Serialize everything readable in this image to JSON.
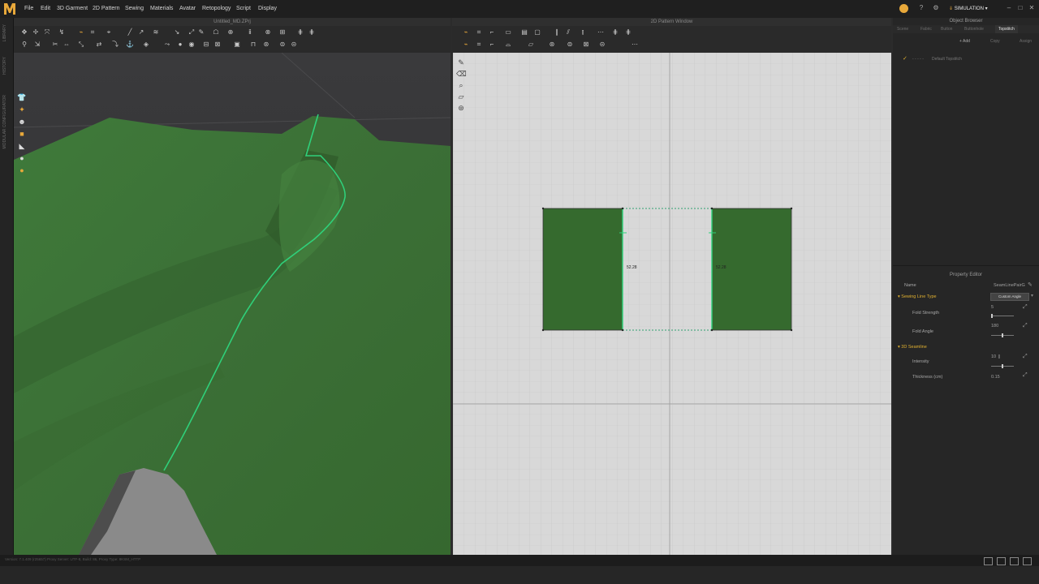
{
  "app": {
    "menu": [
      "File",
      "Edit",
      "3D Garment",
      "2D Pattern",
      "Sewing",
      "Materials",
      "Avatar",
      "Retopology",
      "Script",
      "Display"
    ],
    "mode_label": "SIMULATION",
    "colors": {
      "accent": "#e8a83a",
      "fabric": "#3b6e36",
      "pattern_fill": "#356a2e",
      "seam": "#2fd07a",
      "bg2d": "#d8d8d8"
    }
  },
  "left_strip": {
    "tabs": [
      "LIBRARY",
      "HISTORY",
      "MODULAR CONFIGURATOR"
    ]
  },
  "view3d": {
    "title": "Untitled_MD.ZPrj"
  },
  "view2d": {
    "title": "2D Pattern Window",
    "measurements": [
      "52.28",
      "52.28"
    ]
  },
  "object_browser": {
    "title": "Object Browser",
    "tabs": [
      "Scene",
      "Fabric",
      "Button",
      "Buttonhole",
      "Topstitch"
    ],
    "active_tab": "Topstitch",
    "buttons": {
      "add": "+ Add",
      "copy": "Copy",
      "assign": "Assign"
    },
    "item": "Default Topstitch"
  },
  "property_editor": {
    "title": "Property Editor",
    "name_label": "Name",
    "name_value": "SeamLinePairG",
    "sections": {
      "sewing": "Sewing Line Type",
      "seamline": "3D Seamline"
    },
    "sewing_type_value": "Custom Angle",
    "fold_strength_label": "Fold Strength",
    "fold_strength_value": "5",
    "fold_strength_level": 0.05,
    "fold_angle_label": "Fold Angle",
    "fold_angle_value": "180",
    "fold_angle_level": 0.5,
    "intensity_label": "Intensity",
    "intensity_value": "10",
    "intensity_level": 0.5,
    "thickness_label": "Thickness (cm)",
    "thickness_value": "0.15"
  },
  "status": {
    "text": "Version: 7.1.409 (r25657)    Proxy Server: UTF-8, Build: 86, Proxy Type: 8KSM_HTTP"
  },
  "icons": [
    "logo-icon",
    "pointer-icon",
    "move-icon",
    "pen-icon",
    "seam-icon",
    "sewing-icon",
    "shirt-icon",
    "avatar-icon",
    "camera-icon",
    "settings-icon",
    "help-icon",
    "minimize-icon",
    "maximize-icon",
    "close-icon"
  ]
}
